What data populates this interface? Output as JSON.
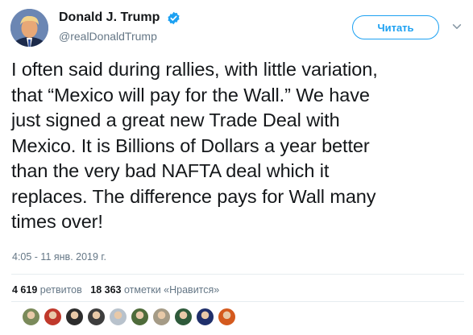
{
  "author": {
    "display_name": "Donald J. Trump",
    "handle": "@realDonaldTrump",
    "verified_icon": "verified-badge-icon"
  },
  "follow_button": {
    "label": "Читать"
  },
  "tweet": {
    "text": "I often said during rallies, with little variation,\nthat “Mexico will pay for the Wall.” We have\njust signed a great new Trade Deal with\nMexico. It is Billions of Dollars a year better\nthan the very bad NAFTA deal which it\nreplaces. The difference pays for Wall many\ntimes over!",
    "timestamp": "4:05 - 11 янв. 2019 г."
  },
  "stats": {
    "retweets_count": "4 619",
    "retweets_label": "ретвитов",
    "likes_count": "18 363",
    "likes_label": "отметки «Нравится»"
  },
  "likers": [
    {
      "color": "#7a8a5a"
    },
    {
      "color": "#c0392b"
    },
    {
      "color": "#2c2c2c"
    },
    {
      "color": "#3d3d3d"
    },
    {
      "color": "#b8c2cc"
    },
    {
      "color": "#4e6b3a"
    },
    {
      "color": "#a59b86"
    },
    {
      "color": "#2e5a3a"
    },
    {
      "color": "#1f2f6b"
    },
    {
      "color": "#d45a1e"
    }
  ],
  "colors": {
    "accent": "#1da1f2",
    "text": "#14171a",
    "muted": "#657786",
    "divider": "#e6ecf0"
  }
}
